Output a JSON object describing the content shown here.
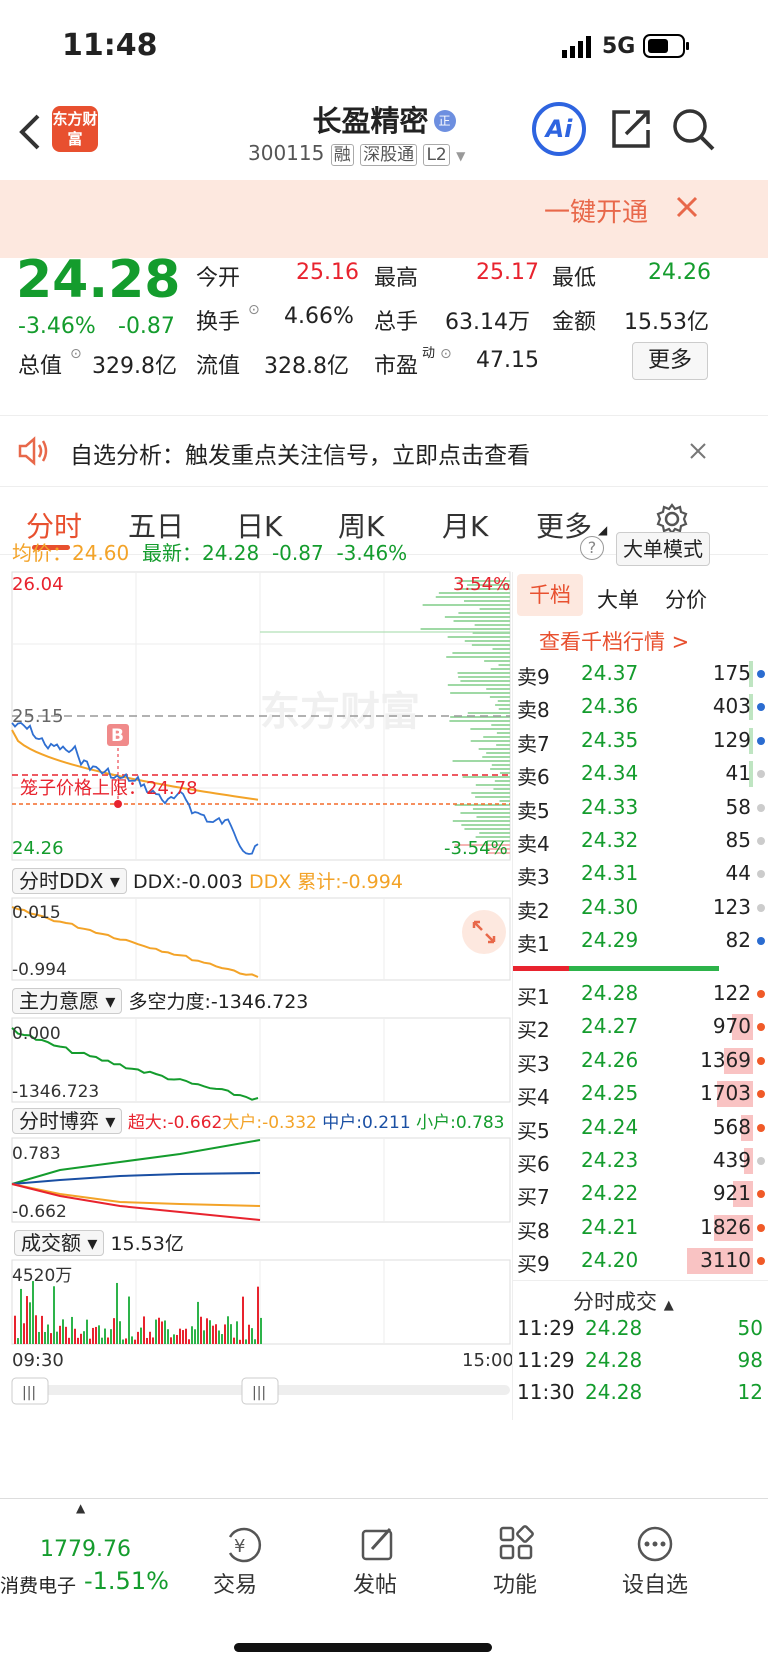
{
  "status": {
    "time": "11:48",
    "network": "5G"
  },
  "header": {
    "logo": "东方财富",
    "name": "长盈精密",
    "code": "300115",
    "tags": [
      "融",
      "深股通",
      "L2"
    ],
    "reg_badge": "正",
    "ai": "Ai"
  },
  "banner": {
    "text": "一键开通"
  },
  "quote": {
    "price": "24.28",
    "pct": "-3.46%",
    "chg": "-0.87",
    "f": [
      {
        "l": "今开",
        "v": "25.16"
      },
      {
        "l": "最高",
        "v": "25.17"
      },
      {
        "l": "最低",
        "v": "24.26"
      },
      {
        "l": "换手",
        "v": "4.66%"
      },
      {
        "l": "总手",
        "v": "63.14万"
      },
      {
        "l": "金额",
        "v": "15.53亿"
      },
      {
        "l": "总值",
        "v": "329.8亿"
      },
      {
        "l": "流值",
        "v": "328.8亿"
      },
      {
        "l": "市盈",
        "v": "47.15"
      }
    ],
    "pe_sup": "动",
    "more": "更多"
  },
  "notice": {
    "text": "自选分析：触发重点关注信号，立即点击查看"
  },
  "tabs": [
    "分时",
    "五日",
    "日K",
    "周K",
    "月K",
    "更多"
  ],
  "info": {
    "avg_label": "均价：",
    "avg": "24.60",
    "latest_label": "最新：",
    "latest": "24.28",
    "chg": "-0.87",
    "pct": "-3.46%",
    "mode": "大单模式"
  },
  "chart": {
    "hi": "26.04",
    "lo": "24.26",
    "up_pct": "3.54%",
    "dn_pct": "-3.54%",
    "prev": "25.15",
    "limit": "笼子价格上限：24.78",
    "b": "B",
    "watermark": "东方财富",
    "t_start": "09:30",
    "t_end": "15:00"
  },
  "ddx": {
    "sel": "分时DDX",
    "ddx": "DDX:-0.003",
    "ddx_sum": "DDX 累计:-0.994",
    "top": "0.015",
    "bottom": "-0.994"
  },
  "zl": {
    "sel": "主力意愿",
    "txt": "多空力度:-1346.723",
    "top": "0.000",
    "bottom": "-1346.723"
  },
  "by": {
    "sel": "分时博弈",
    "cd": "超大:-0.662",
    "dh": "大户:-0.332",
    "zh": "中户:0.211",
    "xh": "小户:0.783",
    "top": "0.783",
    "bottom": "-0.662"
  },
  "vol": {
    "sel": "成交额",
    "txt": "15.53亿",
    "max": "4520万"
  },
  "ob_tabs": [
    "千档",
    "大单",
    "分价"
  ],
  "ob_link": "查看千档行情 >",
  "sells": [
    [
      "卖9",
      "24.37",
      "175"
    ],
    [
      "卖8",
      "24.36",
      "403"
    ],
    [
      "卖7",
      "24.35",
      "129"
    ],
    [
      "卖6",
      "24.34",
      "41"
    ],
    [
      "卖5",
      "24.33",
      "58"
    ],
    [
      "卖4",
      "24.32",
      "85"
    ],
    [
      "卖3",
      "24.31",
      "44"
    ],
    [
      "卖2",
      "24.30",
      "123"
    ],
    [
      "卖1",
      "24.29",
      "82"
    ]
  ],
  "buys": [
    [
      "买1",
      "24.28",
      "122"
    ],
    [
      "买2",
      "24.27",
      "970"
    ],
    [
      "买3",
      "24.26",
      "1369"
    ],
    [
      "买4",
      "24.25",
      "1703"
    ],
    [
      "买5",
      "24.24",
      "568"
    ],
    [
      "买6",
      "24.23",
      "439"
    ],
    [
      "买7",
      "24.22",
      "921"
    ],
    [
      "买8",
      "24.21",
      "1826"
    ],
    [
      "买9",
      "24.20",
      "3110"
    ]
  ],
  "ticks_title": "分时成交",
  "ticks": [
    [
      "11:29",
      "24.28",
      "50"
    ],
    [
      "11:29",
      "24.28",
      "98"
    ],
    [
      "11:30",
      "24.28",
      "12"
    ]
  ],
  "bottom": {
    "idx": "1779.76",
    "sector": "消费电子",
    "sector_pct": "-1.51%",
    "items": [
      "交易",
      "发帖",
      "功能",
      "设自选"
    ]
  },
  "colors": {
    "up": "#e8232e",
    "down": "#149c2d",
    "avg": "#f3a328",
    "banner_bg": "#fde8df"
  }
}
